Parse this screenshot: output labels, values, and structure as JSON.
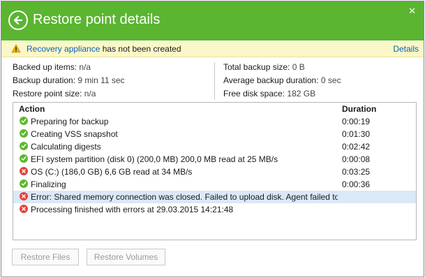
{
  "window": {
    "title": "Restore point details"
  },
  "warning": {
    "link_text": "Recovery appliance",
    "text": "has not been created",
    "details_link": "Details"
  },
  "stats": {
    "backed_up_items_label": "Backed up items:",
    "backed_up_items_value": "n/a",
    "backup_duration_label": "Backup duration:",
    "backup_duration_value": "9 min 11 sec",
    "restore_point_size_label": "Restore point size:",
    "restore_point_size_value": "n/a",
    "total_backup_size_label": "Total backup size:",
    "total_backup_size_value": "0 B",
    "avg_backup_duration_label": "Average backup duration:",
    "avg_backup_duration_value": "0 sec",
    "free_disk_space_label": "Free disk space:",
    "free_disk_space_value": "182 GB"
  },
  "grid": {
    "headers": {
      "action": "Action",
      "duration": "Duration"
    },
    "rows": [
      {
        "status": "success",
        "action": "Preparing for backup",
        "duration": "0:00:19"
      },
      {
        "status": "success",
        "action": "Creating VSS snapshot",
        "duration": "0:01:30"
      },
      {
        "status": "success",
        "action": "Calculating digests",
        "duration": "0:02:42"
      },
      {
        "status": "success",
        "action": "EFI system partition (disk 0) (200,0 MB) 200,0 MB read at 25 MB/s",
        "duration": "0:00:08"
      },
      {
        "status": "error",
        "action": "OS (C:) (186,0 GB) 6,6 GB read at 34 MB/s",
        "duration": "0:03:25"
      },
      {
        "status": "success",
        "action": "Finalizing",
        "duration": "0:00:36"
      },
      {
        "status": "error",
        "action": "Error: Shared memory connection was closed. Failed to upload disk. Agent failed to pro",
        "duration": "",
        "selected": true
      },
      {
        "status": "error",
        "action": "Processing finished with errors at 29.03.2015 14:21:48",
        "duration": ""
      }
    ]
  },
  "buttons": {
    "restore_files": "Restore Files",
    "restore_volumes": "Restore Volumes"
  },
  "colors": {
    "header_green": "#5bb531",
    "warning_bg": "#fbf7c8",
    "link_blue": "#0a62b8",
    "success_icon": "#5cb82e",
    "error_icon": "#e0443c",
    "selected_row": "#dbe8f7"
  },
  "icons": {
    "back": "back-arrow-icon",
    "close": "close-icon",
    "warning": "warning-icon",
    "success": "check-circle-icon",
    "error": "x-circle-icon"
  }
}
